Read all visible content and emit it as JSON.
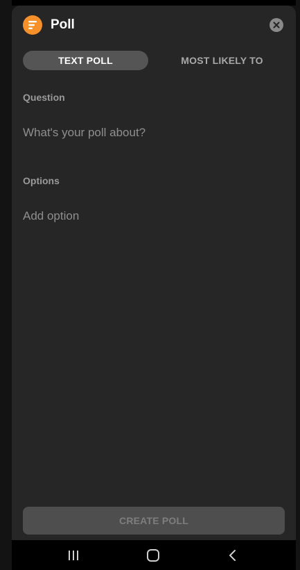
{
  "header": {
    "title": "Poll",
    "logo_icon": "poll-list-icon",
    "close_icon": "close-icon"
  },
  "tabs": [
    {
      "label": "TEXT POLL",
      "active": true
    },
    {
      "label": "MOST LIKELY TO",
      "active": false
    }
  ],
  "question": {
    "label": "Question",
    "placeholder": "What's your poll about?",
    "value": ""
  },
  "options": {
    "label": "Options",
    "placeholder": "Add option",
    "value": ""
  },
  "footer": {
    "create_label": "CREATE POLL",
    "enabled": false
  },
  "navbar": {
    "icons": [
      "recents-icon",
      "home-icon",
      "back-icon"
    ]
  },
  "colors": {
    "accent": "#f5902a",
    "sheet_background": "#262626",
    "active_tab": "#555555",
    "disabled_button": "#4e4e4e"
  }
}
